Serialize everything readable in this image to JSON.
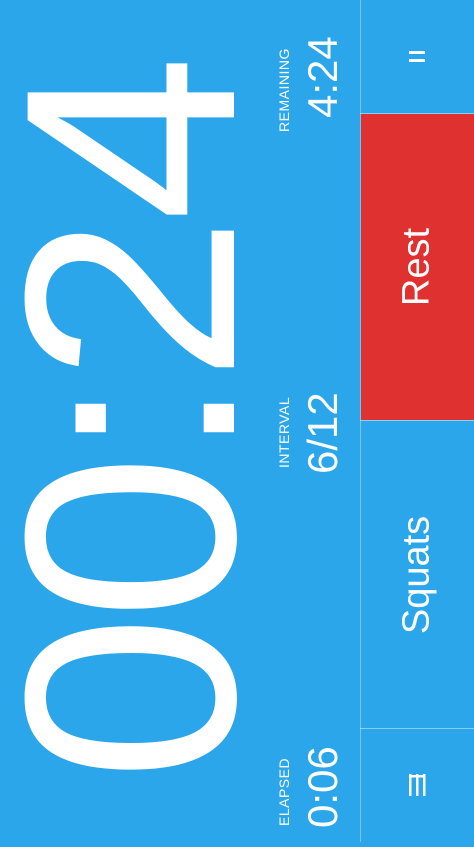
{
  "timer": {
    "display": "00:24"
  },
  "stats": {
    "remaining": {
      "label": "REMAINING",
      "value": "4:24"
    },
    "interval": {
      "label": "INTERVAL",
      "value": "6/12"
    },
    "elapsed": {
      "label": "ELAPSED",
      "value": "0:06"
    }
  },
  "panel": {
    "current_phase": "Rest",
    "next_exercise": "Squats",
    "pause_icon": "pause-icon",
    "menu_icon": "menu-icon"
  },
  "colors": {
    "background": "#2ba6ea",
    "rest": "#e03131",
    "text": "#ffffff"
  }
}
